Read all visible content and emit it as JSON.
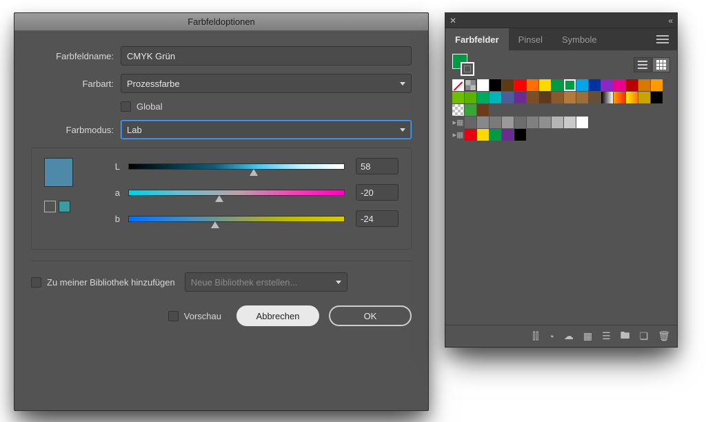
{
  "dialog": {
    "title": "Farbfeldoptionen",
    "name_label": "Farbfeldname:",
    "name_value": "CMYK Grün",
    "type_label": "Farbart:",
    "type_value": "Prozessfarbe",
    "global_label": "Global",
    "mode_label": "Farbmodus:",
    "mode_value": "Lab",
    "channels": [
      {
        "id": "L",
        "label": "L",
        "value": "58",
        "thumb_pct": 58
      },
      {
        "id": "a",
        "label": "a",
        "value": "-20",
        "thumb_pct": 42
      },
      {
        "id": "b",
        "label": "b",
        "value": "-24",
        "thumb_pct": 40
      }
    ],
    "preview_color": "#4e8aa7",
    "global_swatch_color": "#3b9c9b",
    "addlib_label": "Zu meiner Bibliothek hinzufügen",
    "addlib_select": "Neue Bibliothek erstellen...",
    "preview_cb_label": "Vorschau",
    "cancel": "Abbrechen",
    "ok": "OK"
  },
  "panel": {
    "tabs": [
      "Farbfelder",
      "Pinsel",
      "Symbole"
    ],
    "active_tab": 0,
    "rows": [
      [
        "none",
        "reg",
        "#ffffff",
        "#000000",
        "#5b3b14",
        "#ff0000",
        "#ff6f00",
        "#ffd800",
        "#009944",
        "sel:#009944",
        "#00a6e8",
        "#0033a0",
        "#8a28c7",
        "#ec008c",
        "#b80000",
        "#d67900",
        "#ff9a00"
      ],
      [
        "#6fbf00",
        "#59b300",
        "#00a95c",
        "#00b5b8",
        "#4b5d9a",
        "#6a2c91",
        "#7c4e25",
        "#5c3a1a",
        "#8a5a2b",
        "#b37a3c",
        "#9c6e3a",
        "#665034",
        "grad:#000-#fff",
        "grad:#ff9f00-#ff2a00",
        "grad:#ffea00-#ff7a00",
        "#c9a400",
        "#000000"
      ],
      [
        "checker",
        "#3aa33a",
        "#6b3b1a"
      ],
      [
        "folder",
        "#666",
        "#888",
        "#7a7a7a",
        "#9a9a9a",
        "#6d6d6d",
        "#808080",
        "#8f8f8f",
        "#b5b5b5",
        "#c9c9c9",
        "#ffffff"
      ],
      [
        "folder",
        "#e60012",
        "#ffd800",
        "#009944",
        "#6a2c91",
        "#000000"
      ]
    ],
    "footer_icons": [
      "library-menu-icon",
      "swatch-kinds-icon",
      "cloud-icon",
      "swatch-options-icon",
      "list-icon",
      "folder-new-icon",
      "new-swatch-icon",
      "trash-icon"
    ]
  }
}
